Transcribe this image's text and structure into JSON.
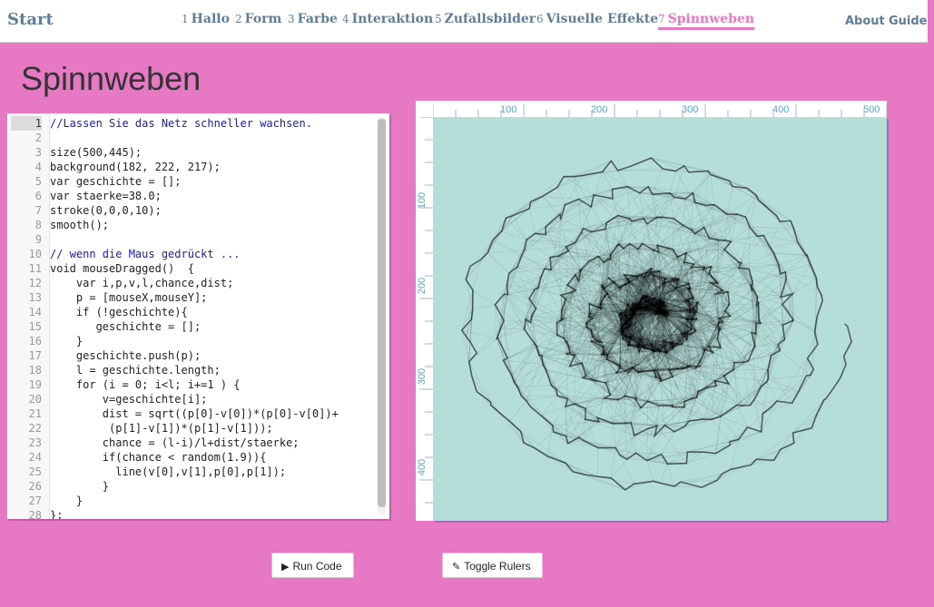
{
  "nav": {
    "brand": "Start",
    "items": [
      {
        "num": "1",
        "label": "Hallo"
      },
      {
        "num": "2",
        "label": "Form"
      },
      {
        "num": "3",
        "label": "Farbe"
      },
      {
        "num": "4",
        "label": "Interaktion"
      },
      {
        "num": "5",
        "label": "Zufallsbilder"
      },
      {
        "num": "6",
        "label": "Visuelle Effekte"
      },
      {
        "num": "7",
        "label": "Spinnweben"
      }
    ],
    "active_index": 6,
    "about": "About",
    "guide": "Guide"
  },
  "page": {
    "title": "Spinnweben"
  },
  "editor": {
    "current_line": 1,
    "lines": [
      {
        "n": "1",
        "t": "//Lassen Sie das Netz schneller wachsen.",
        "comment": true
      },
      {
        "n": "2",
        "t": ""
      },
      {
        "n": "3",
        "t": "size(500,445);"
      },
      {
        "n": "4",
        "t": "background(182, 222, 217);"
      },
      {
        "n": "5",
        "t": "var geschichte = [];"
      },
      {
        "n": "6",
        "t": "var staerke=38.0;"
      },
      {
        "n": "7",
        "t": "stroke(0,0,0,10);"
      },
      {
        "n": "8",
        "t": "smooth();"
      },
      {
        "n": "9",
        "t": ""
      },
      {
        "n": "10",
        "t": "// wenn die Maus gedrückt ...",
        "comment": true
      },
      {
        "n": "11",
        "t": "void mouseDragged()  {"
      },
      {
        "n": "12",
        "t": "    var i,p,v,l,chance,dist;"
      },
      {
        "n": "13",
        "t": "    p = [mouseX,mouseY];"
      },
      {
        "n": "14",
        "t": "    if (!geschichte){"
      },
      {
        "n": "15",
        "t": "       geschichte = [];"
      },
      {
        "n": "16",
        "t": "    }"
      },
      {
        "n": "17",
        "t": "    geschichte.push(p);"
      },
      {
        "n": "18",
        "t": "    l = geschichte.length;"
      },
      {
        "n": "19",
        "t": "    for (i = 0; i<l; i+=1 ) {"
      },
      {
        "n": "20",
        "t": "        v=geschichte[i];"
      },
      {
        "n": "21",
        "t": "        dist = sqrt((p[0]-v[0])*(p[0]-v[0])+"
      },
      {
        "n": "22",
        "t": "         (p[1]-v[1])*(p[1]-v[1]));"
      },
      {
        "n": "23",
        "t": "        chance = (l-i)/l+dist/staerke;"
      },
      {
        "n": "24",
        "t": "        if(chance < random(1.9)){"
      },
      {
        "n": "25",
        "t": "          line(v[0],v[1],p[0],p[1]);"
      },
      {
        "n": "26",
        "t": "        }"
      },
      {
        "n": "27",
        "t": "    }"
      },
      {
        "n": "28",
        "t": "};"
      }
    ]
  },
  "rulers": {
    "x_ticks": [
      "100",
      "200",
      "300",
      "400",
      "500"
    ],
    "y_ticks": [
      "100",
      "200",
      "300",
      "400"
    ]
  },
  "canvas": {
    "background": "#b6ded9",
    "stroke": "#000000"
  },
  "buttons": {
    "run": {
      "label": "Run Code",
      "icon": "play-icon"
    },
    "rulers": {
      "label": "Toggle Rulers",
      "icon": "pencil-icon"
    }
  },
  "colors": {
    "accent": "#e678c4",
    "nav_text": "#5f7d96",
    "comment": "#1a1ab5"
  }
}
